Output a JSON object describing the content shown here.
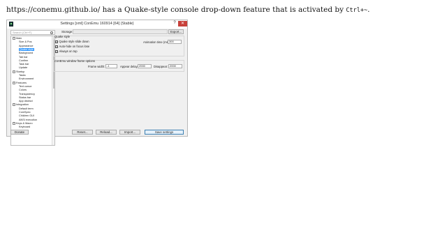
{
  "caption": {
    "text": "https://conemu.github.io/ has a Quake-style console drop-down feature that is activated by ",
    "key": "Ctrl+~",
    "tail": "."
  },
  "window": {
    "title": "Settings [xml] ConEmu 160914 [64] {Stable}",
    "help": "?",
    "close": "✕"
  },
  "search": {
    "placeholder": "Search (Ctrl+F)"
  },
  "tree": [
    {
      "label": "Main",
      "level": 0,
      "exp": "⊟"
    },
    {
      "label": "Size & Pos",
      "level": 1
    },
    {
      "label": "Appearance",
      "level": 1
    },
    {
      "label": "Quake style",
      "level": 1,
      "selected": true
    },
    {
      "label": "Background",
      "level": 1
    },
    {
      "label": "Tab bar",
      "level": 1
    },
    {
      "label": "Confirm",
      "level": 1
    },
    {
      "label": "Task bar",
      "level": 1
    },
    {
      "label": "Update",
      "level": 1
    },
    {
      "label": "Startup",
      "level": 0,
      "exp": "⊟"
    },
    {
      "label": "Tasks",
      "level": 1
    },
    {
      "label": "Environment",
      "level": 1
    },
    {
      "label": "Features",
      "level": 0,
      "exp": "⊟"
    },
    {
      "label": "Text cursor",
      "level": 1
    },
    {
      "label": "Colors",
      "level": 1
    },
    {
      "label": "Transparency",
      "level": 1
    },
    {
      "label": "Status bar",
      "level": 1
    },
    {
      "label": "App distinct",
      "level": 1
    },
    {
      "label": "Integration",
      "level": 0,
      "exp": "⊟"
    },
    {
      "label": "Default term",
      "level": 1
    },
    {
      "label": "ComSpec",
      "level": 1
    },
    {
      "label": "Children GUI",
      "level": 1
    },
    {
      "label": "ANSI execution",
      "level": 1
    },
    {
      "label": "Keys & Macro",
      "level": 0,
      "exp": "⊟"
    },
    {
      "label": "Keyboard",
      "level": 1
    }
  ],
  "storage": {
    "label": "Storage:",
    "value": "",
    "export": "Export..."
  },
  "quake": {
    "title": "Quake style",
    "options": [
      {
        "label": "Quake style slide down",
        "checked": true
      },
      {
        "label": "Auto-hide on focus lose",
        "checked": true
      },
      {
        "label": "Always on top",
        "checked": true
      }
    ],
    "animation_label": "Animation time (ms):",
    "animation_value": "300"
  },
  "frame": {
    "title": "ConEmu window frame options",
    "width_label": "Frame width:",
    "width_value": "-1",
    "appear_label": "Appear delay:",
    "appear_value": "2000",
    "disappear_label": "Disappear:",
    "disappear_value": "2000"
  },
  "footer": {
    "donate": "Donate",
    "reset": "Reset...",
    "reload": "Reload...",
    "import": "Import...",
    "save": "Save settings"
  }
}
